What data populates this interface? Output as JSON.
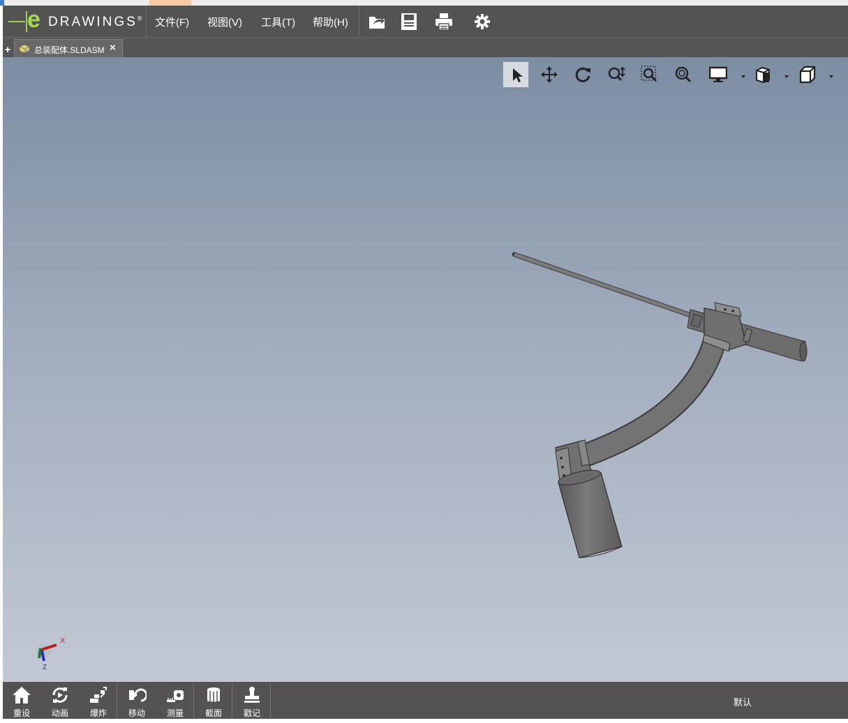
{
  "app": {
    "logo_text": "DRAWINGS",
    "logo_letter": "e",
    "logo_mark": "®"
  },
  "menu": [
    {
      "label": "文件(F)"
    },
    {
      "label": "视图(V)"
    },
    {
      "label": "工具(T)"
    },
    {
      "label": "帮助(H)"
    }
  ],
  "toolbar_icons": [
    "open-file-icon",
    "save-icon",
    "print-icon",
    "gear-icon"
  ],
  "tabs": {
    "add_label": "+",
    "document": {
      "name": "总装配体.SLDASM",
      "close": "×",
      "icon": "assembly-icon"
    }
  },
  "view_tools": [
    {
      "icon": "select-arrow-icon",
      "active": true
    },
    {
      "icon": "pan-icon"
    },
    {
      "icon": "rotate-icon"
    },
    {
      "icon": "zoom-icon"
    },
    {
      "icon": "zoom-to-area-icon"
    },
    {
      "icon": "zoom-to-fit-icon"
    },
    {
      "icon": "display-style-icon",
      "dropdown": true
    },
    {
      "icon": "views-icon",
      "dropdown": true
    },
    {
      "icon": "standard-view-cube-icon",
      "dropdown": true
    }
  ],
  "triad": {
    "x_label": "X",
    "z_label": "Z"
  },
  "bottom_tools": [
    {
      "label": "重设",
      "icon": "home-icon"
    },
    {
      "label": "动画",
      "icon": "animate-icon"
    },
    {
      "label": "爆炸",
      "icon": "explode-icon"
    },
    {
      "label": "移动",
      "icon": "move-icon"
    },
    {
      "label": "测量",
      "icon": "measure-icon"
    },
    {
      "label": "截面",
      "icon": "section-icon"
    },
    {
      "label": "戳记",
      "icon": "stamp-icon"
    }
  ],
  "config_label": "默认",
  "colors": {
    "bar": "#535353",
    "logo_green": "#a6d94f",
    "viewport_top": "#7d8da2",
    "viewport_bottom": "#c2c9d4",
    "model_gray": "#6e6e6e"
  }
}
